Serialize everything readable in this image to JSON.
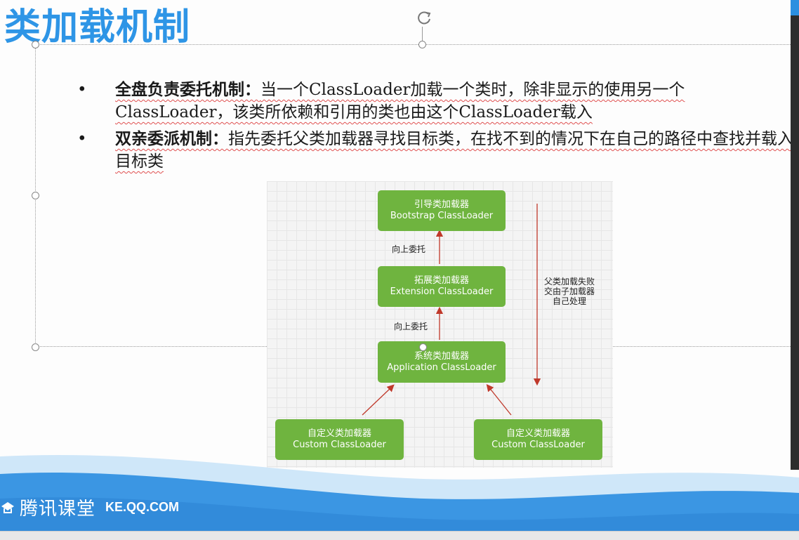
{
  "slide": {
    "title": "类加载机制"
  },
  "bullets": [
    {
      "marker": "•",
      "term": "全盘负责委托机制：",
      "desc": "当一个ClassLoader加载一个类时，除非显示的使用另一个ClassLoader，该类所依赖和引用的类也由这个ClassLoader载入"
    },
    {
      "marker": "•",
      "term": "双亲委派机制：",
      "desc": "指先委托父类加载器寻找目标类，在找不到的情况下在自己的路径中查找并载入目标类"
    }
  ],
  "diagram": {
    "bootstrap": {
      "cn": "引导类加载器",
      "en": "Bootstrap ClassLoader"
    },
    "extension": {
      "cn": "拓展类加载器",
      "en": "Extension ClassLoader"
    },
    "application": {
      "cn": "系统类加载器",
      "en": "Application ClassLoader"
    },
    "custom_left": {
      "cn": "自定义类加载器",
      "en": "Custom ClassLoader"
    },
    "custom_right": {
      "cn": "自定义类加载器",
      "en": "Custom ClassLoader"
    },
    "delegate_label_1": "向上委托",
    "delegate_label_2": "向上委托",
    "fallback_label": [
      "父类加载失败",
      "交由子加载器",
      "自己处理"
    ],
    "node_color": "#6fb43f",
    "arrow_color": "#c0392b"
  },
  "footer": {
    "brand_name": "腾讯课堂",
    "brand_url": "KE.QQ.COM",
    "brand_icon": "graduation-cap-icon"
  },
  "colors": {
    "title": "#2e95e6",
    "wave_light": "#bfe0f7",
    "wave_dark": "#2f8fe0"
  }
}
